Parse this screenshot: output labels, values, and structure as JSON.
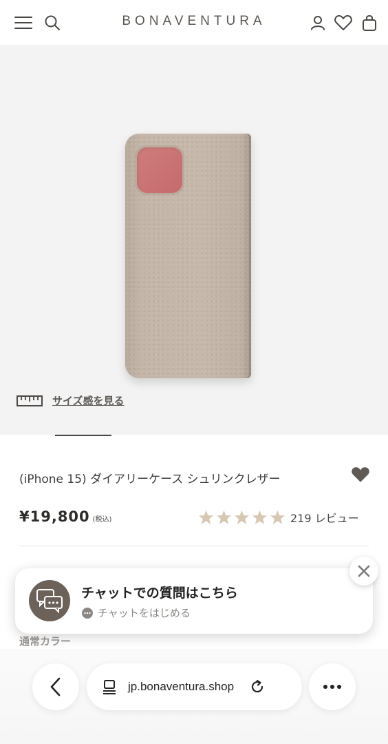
{
  "header": {
    "brand": "BONAVENTURA",
    "icons": [
      "menu-icon",
      "search-icon",
      "account-icon",
      "heart-icon",
      "bag-icon"
    ]
  },
  "gallery": {
    "size_link_label": "サイズ感を見る",
    "case_color": "#c4b6a9",
    "camera_color": "#cc7778"
  },
  "product": {
    "title": "(iPhone 15) ダイアリーケース シュリンクレザー",
    "price": "¥19,800",
    "tax_label": "(税込)",
    "rating": 5,
    "review_count_text": "219 レビュー",
    "color_section_label": "通常カラー"
  },
  "chat": {
    "title": "チャットでの質問はこちら",
    "subtitle": "チャットをはじめる"
  },
  "browser": {
    "url": "jp.bonaventura.shop"
  },
  "colors": {
    "star": "#d6c8b3",
    "accent_dark": "#5f5a56"
  }
}
